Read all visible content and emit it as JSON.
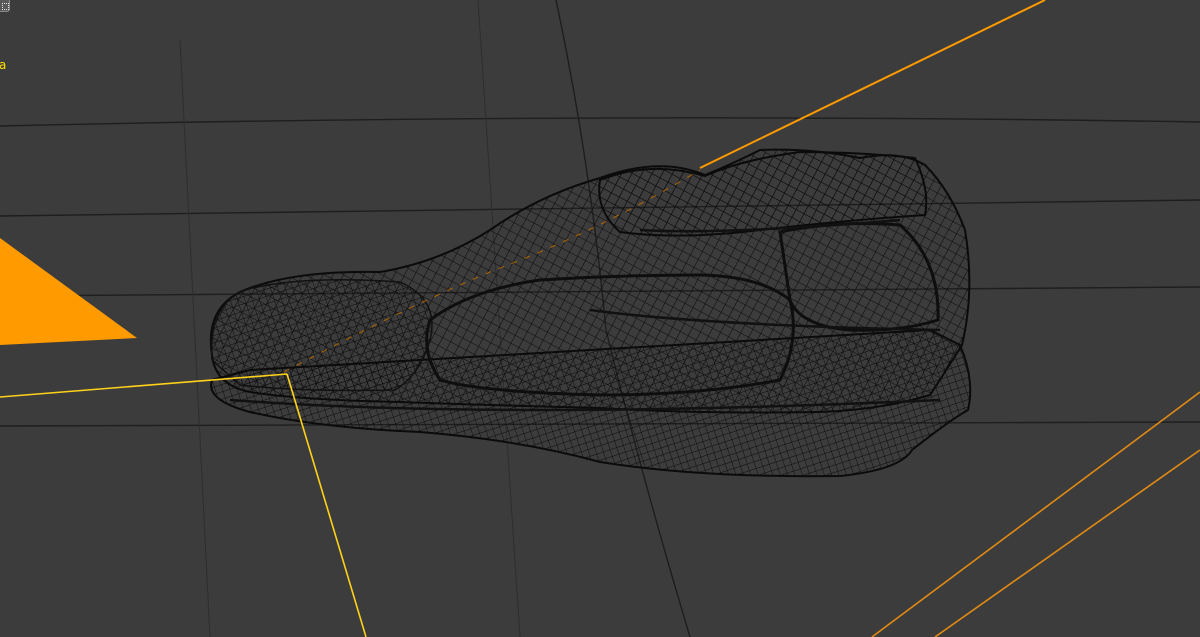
{
  "viewport": {
    "background_color": "#3c3c3c",
    "grid_line_color": "#1e1e1e",
    "selection_outline_color": "#ffd21a",
    "camera_color": "#ff9a00",
    "wireframe_color": "#0b0b0b",
    "object_label": "a",
    "object_label_color": "#ffe100",
    "corner_button_icon": "dotted-square-icon"
  }
}
